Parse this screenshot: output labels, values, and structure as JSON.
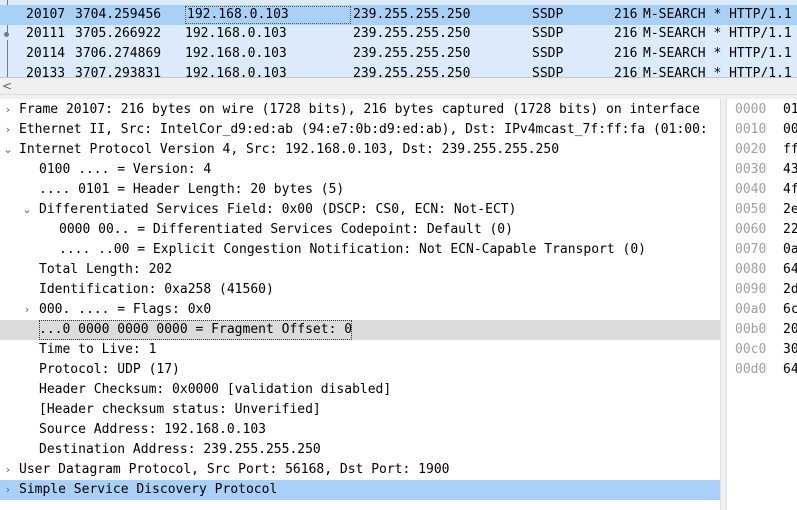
{
  "packet_list": {
    "rows": [
      {
        "no": "20107",
        "time": "3704.259456",
        "src": "192.168.0.103",
        "dst": "239.255.255.250",
        "proto": "SSDP",
        "len": "216",
        "info": "M-SEARCH * HTTP/1.1"
      },
      {
        "no": "20111",
        "time": "3705.266922",
        "src": "192.168.0.103",
        "dst": "239.255.255.250",
        "proto": "SSDP",
        "len": "216",
        "info": "M-SEARCH * HTTP/1.1"
      },
      {
        "no": "20114",
        "time": "3706.274869",
        "src": "192.168.0.103",
        "dst": "239.255.255.250",
        "proto": "SSDP",
        "len": "216",
        "info": "M-SEARCH * HTTP/1.1"
      },
      {
        "no": "20133",
        "time": "3707.293831",
        "src": "192.168.0.103",
        "dst": "239.255.255.250",
        "proto": "SSDP",
        "len": "216",
        "info": "M-SEARCH * HTTP/1.1"
      }
    ]
  },
  "scrollbar": {
    "left_arrow": "<"
  },
  "details": {
    "arrows": {
      "collapsed": "›",
      "expanded": "⌄"
    },
    "rows": [
      {
        "text": "Frame 20107: 216 bytes on wire (1728 bits), 216 bytes captured (1728 bits) on interface",
        "state": "collapsed"
      },
      {
        "text": "Ethernet II, Src: IntelCor_d9:ed:ab (94:e7:0b:d9:ed:ab), Dst: IPv4mcast_7f:ff:fa (01:00:",
        "state": "collapsed"
      },
      {
        "text": "Internet Protocol Version 4, Src: 192.168.0.103, Dst: 239.255.255.250",
        "state": "expanded"
      },
      {
        "text": "0100 .... = Version: 4",
        "state": "leaf"
      },
      {
        "text": ".... 0101 = Header Length: 20 bytes (5)",
        "state": "leaf"
      },
      {
        "text": "Differentiated Services Field: 0x00 (DSCP: CS0, ECN: Not-ECT)",
        "state": "expanded"
      },
      {
        "text": "0000 00.. = Differentiated Services Codepoint: Default (0)",
        "state": "leaf"
      },
      {
        "text": ".... ..00 = Explicit Congestion Notification: Not ECN-Capable Transport (0)",
        "state": "leaf"
      },
      {
        "text": "Total Length: 202",
        "state": "leaf"
      },
      {
        "text": "Identification: 0xa258 (41560)",
        "state": "leaf"
      },
      {
        "text": "000. .... = Flags: 0x0",
        "state": "collapsed"
      },
      {
        "text": "...0 0000 0000 0000 = Fragment Offset: 0",
        "state": "leaf"
      },
      {
        "text": "Time to Live: 1",
        "state": "leaf"
      },
      {
        "text": "Protocol: UDP (17)",
        "state": "leaf"
      },
      {
        "text": "Header Checksum: 0x0000 [validation disabled]",
        "state": "leaf"
      },
      {
        "text": "[Header checksum status: Unverified]",
        "state": "leaf"
      },
      {
        "text": "Source Address: 192.168.0.103",
        "state": "leaf"
      },
      {
        "text": "Destination Address: 239.255.255.250",
        "state": "leaf"
      },
      {
        "text": "User Datagram Protocol, Src Port: 56168, Dst Port: 1900",
        "state": "collapsed"
      },
      {
        "text": "Simple Service Discovery Protocol",
        "state": "collapsed"
      }
    ]
  },
  "bytes": {
    "rows": [
      {
        "offset": "0000",
        "hex": "01"
      },
      {
        "offset": "0010",
        "hex": "00"
      },
      {
        "offset": "0020",
        "hex": "ff"
      },
      {
        "offset": "0030",
        "hex": "43"
      },
      {
        "offset": "0040",
        "hex": "4f"
      },
      {
        "offset": "0050",
        "hex": "2e"
      },
      {
        "offset": "0060",
        "hex": "22"
      },
      {
        "offset": "0070",
        "hex": "0a"
      },
      {
        "offset": "0080",
        "hex": "64"
      },
      {
        "offset": "0090",
        "hex": "2d"
      },
      {
        "offset": "00a0",
        "hex": "6c"
      },
      {
        "offset": "00b0",
        "hex": "20"
      },
      {
        "offset": "00c0",
        "hex": "30"
      },
      {
        "offset": "00d0",
        "hex": "64"
      }
    ]
  },
  "colors": {
    "selection_blue": "#a9d1f7",
    "row_tint": "#dcebfc",
    "gray_highlight": "#dcdcdc"
  }
}
